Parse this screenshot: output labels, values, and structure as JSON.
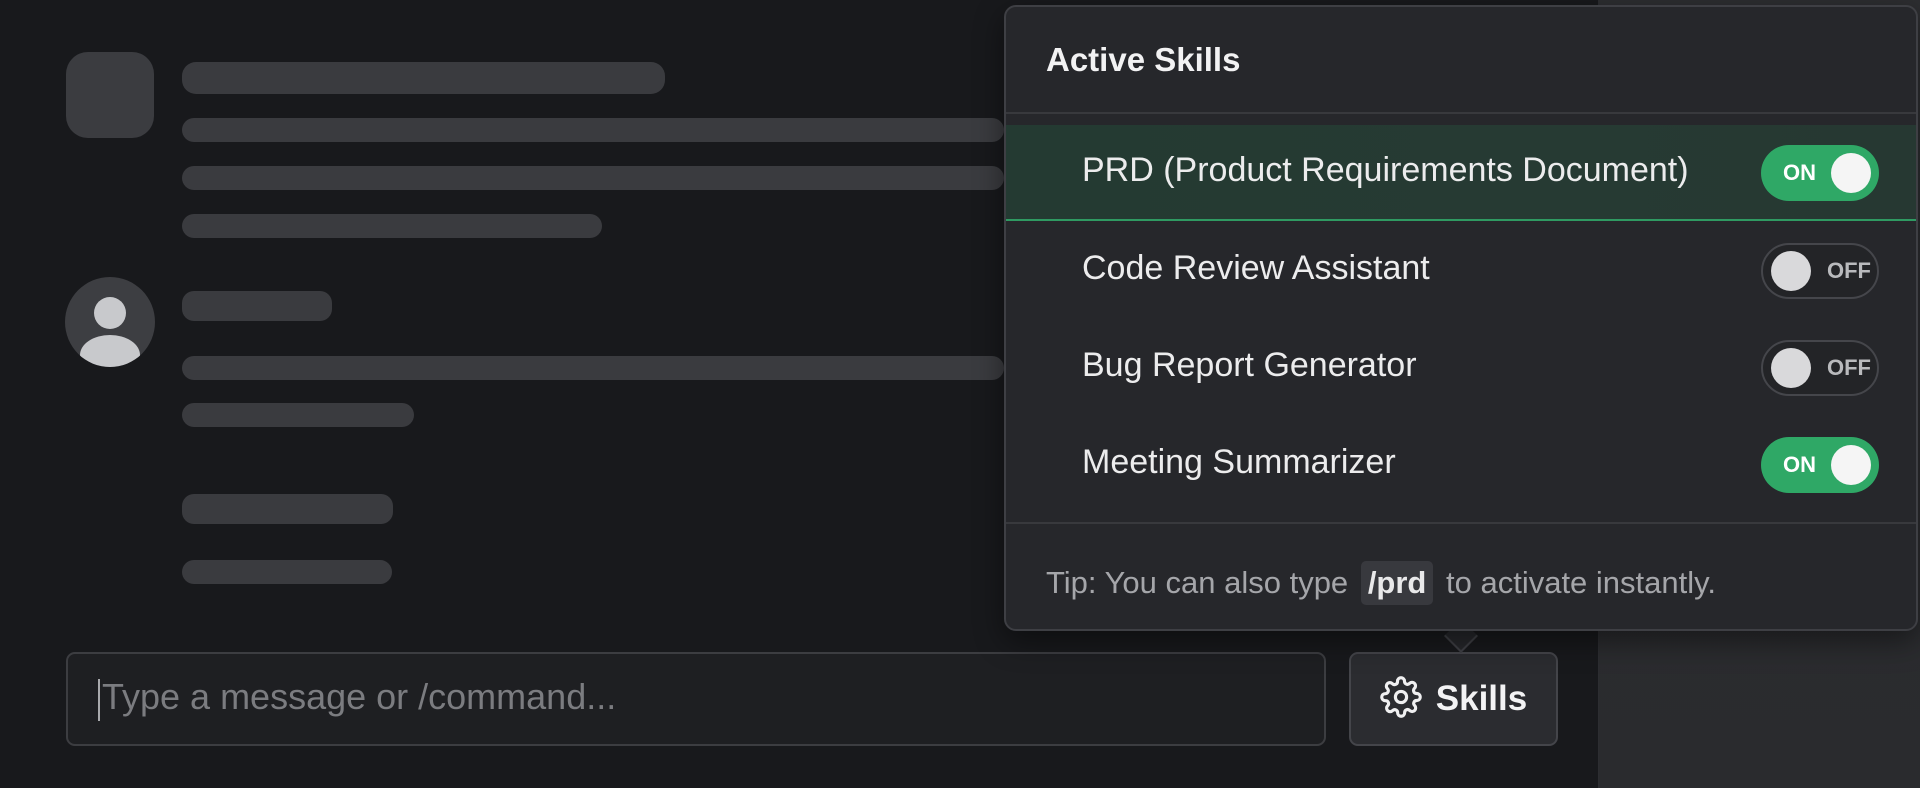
{
  "chat": {
    "input_placeholder": "Type a message or /command...",
    "skills_button_label": "Skills",
    "skills_button_icon": "gear-icon"
  },
  "skills_popover": {
    "title": "Active Skills",
    "skills": [
      {
        "name": "PRD (Product Requirements Document)",
        "state": "ON",
        "enabled": true
      },
      {
        "name": "Code Review Assistant",
        "state": "OFF",
        "enabled": false
      },
      {
        "name": "Bug Report Generator",
        "state": "OFF",
        "enabled": false
      },
      {
        "name": "Meeting Summarizer",
        "state": "ON",
        "enabled": true
      }
    ],
    "tip_prefix": "Tip: You can also type",
    "tip_command": "/prd",
    "tip_suffix": "to activate instantly."
  },
  "colors": {
    "accent_green": "#2fa866",
    "background": "#18191c",
    "popover": "#26272b"
  }
}
